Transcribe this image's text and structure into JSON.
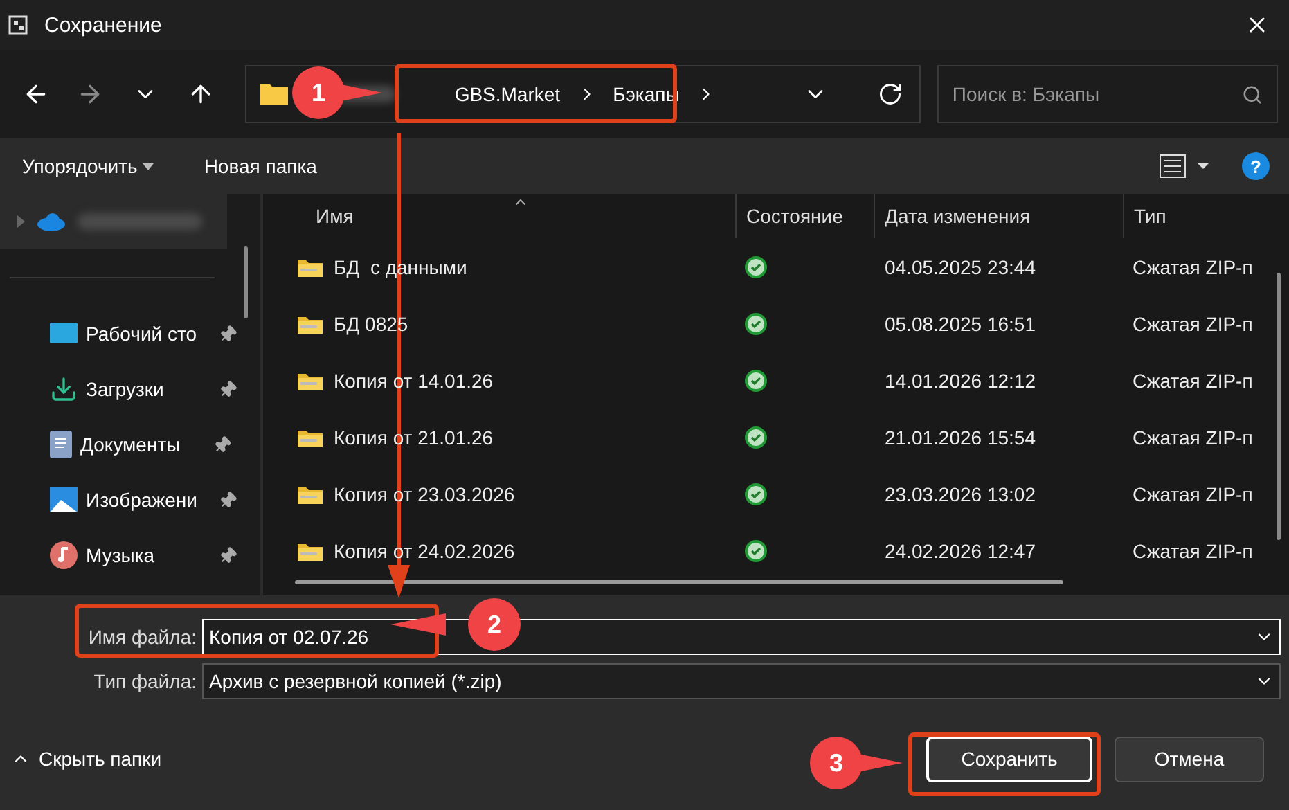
{
  "window": {
    "title": "Сохранение"
  },
  "address_bar": {
    "path": [
      "GBS.Market",
      "Бэкапы"
    ]
  },
  "search": {
    "placeholder": "Поиск в: Бэкапы"
  },
  "toolbar": {
    "organize": "Упорядочить",
    "new_folder": "Новая папка",
    "help": "?"
  },
  "sidebar": {
    "items": [
      {
        "kind": "cloud",
        "selected": true
      },
      {
        "label": "Рабочий сто",
        "kind": "desktop",
        "pinned": true,
        "selected": false
      },
      {
        "label": "Загрузки",
        "kind": "downloads",
        "pinned": true,
        "selected": false
      },
      {
        "label": "Документы",
        "kind": "documents",
        "pinned": true,
        "selected": false
      },
      {
        "label": "Изображени",
        "kind": "images",
        "pinned": true,
        "selected": false
      },
      {
        "label": "Музыка",
        "kind": "music",
        "pinned": true,
        "selected": false
      }
    ]
  },
  "table": {
    "columns": [
      "Имя",
      "Состояние",
      "Дата изменения",
      "Тип"
    ],
    "rows": [
      {
        "name": "БД  с данными",
        "synced": true,
        "date": "04.05.2025 23:44",
        "type": "Сжатая ZIP-п"
      },
      {
        "name": "БД 0825",
        "synced": true,
        "date": "05.08.2025 16:51",
        "type": "Сжатая ZIP-п"
      },
      {
        "name": "Копия от 14.01.26",
        "synced": true,
        "date": "14.01.2026 12:12",
        "type": "Сжатая ZIP-п"
      },
      {
        "name": "Копия от 21.01.26",
        "synced": true,
        "date": "21.01.2026 15:54",
        "type": "Сжатая ZIP-п"
      },
      {
        "name": "Копия от 23.03.2026",
        "synced": true,
        "date": "23.03.2026 13:02",
        "type": "Сжатая ZIP-п"
      },
      {
        "name": "Копия от 24.02.2026",
        "synced": true,
        "date": "24.02.2026 12:47",
        "type": "Сжатая ZIP-п"
      }
    ]
  },
  "file_name": {
    "label": "Имя файла:",
    "value": "Копия от 02.07.26"
  },
  "file_type": {
    "label": "Тип файла:",
    "value": "Архив с резервной копией (*.zip)"
  },
  "hide_folders": "Скрыть папки",
  "buttons": [
    {
      "label": "Сохранить",
      "default": true
    },
    {
      "label": "Отмена",
      "default": false
    }
  ],
  "callouts": [
    {
      "number": "1"
    },
    {
      "number": "2"
    },
    {
      "number": "3"
    }
  ]
}
